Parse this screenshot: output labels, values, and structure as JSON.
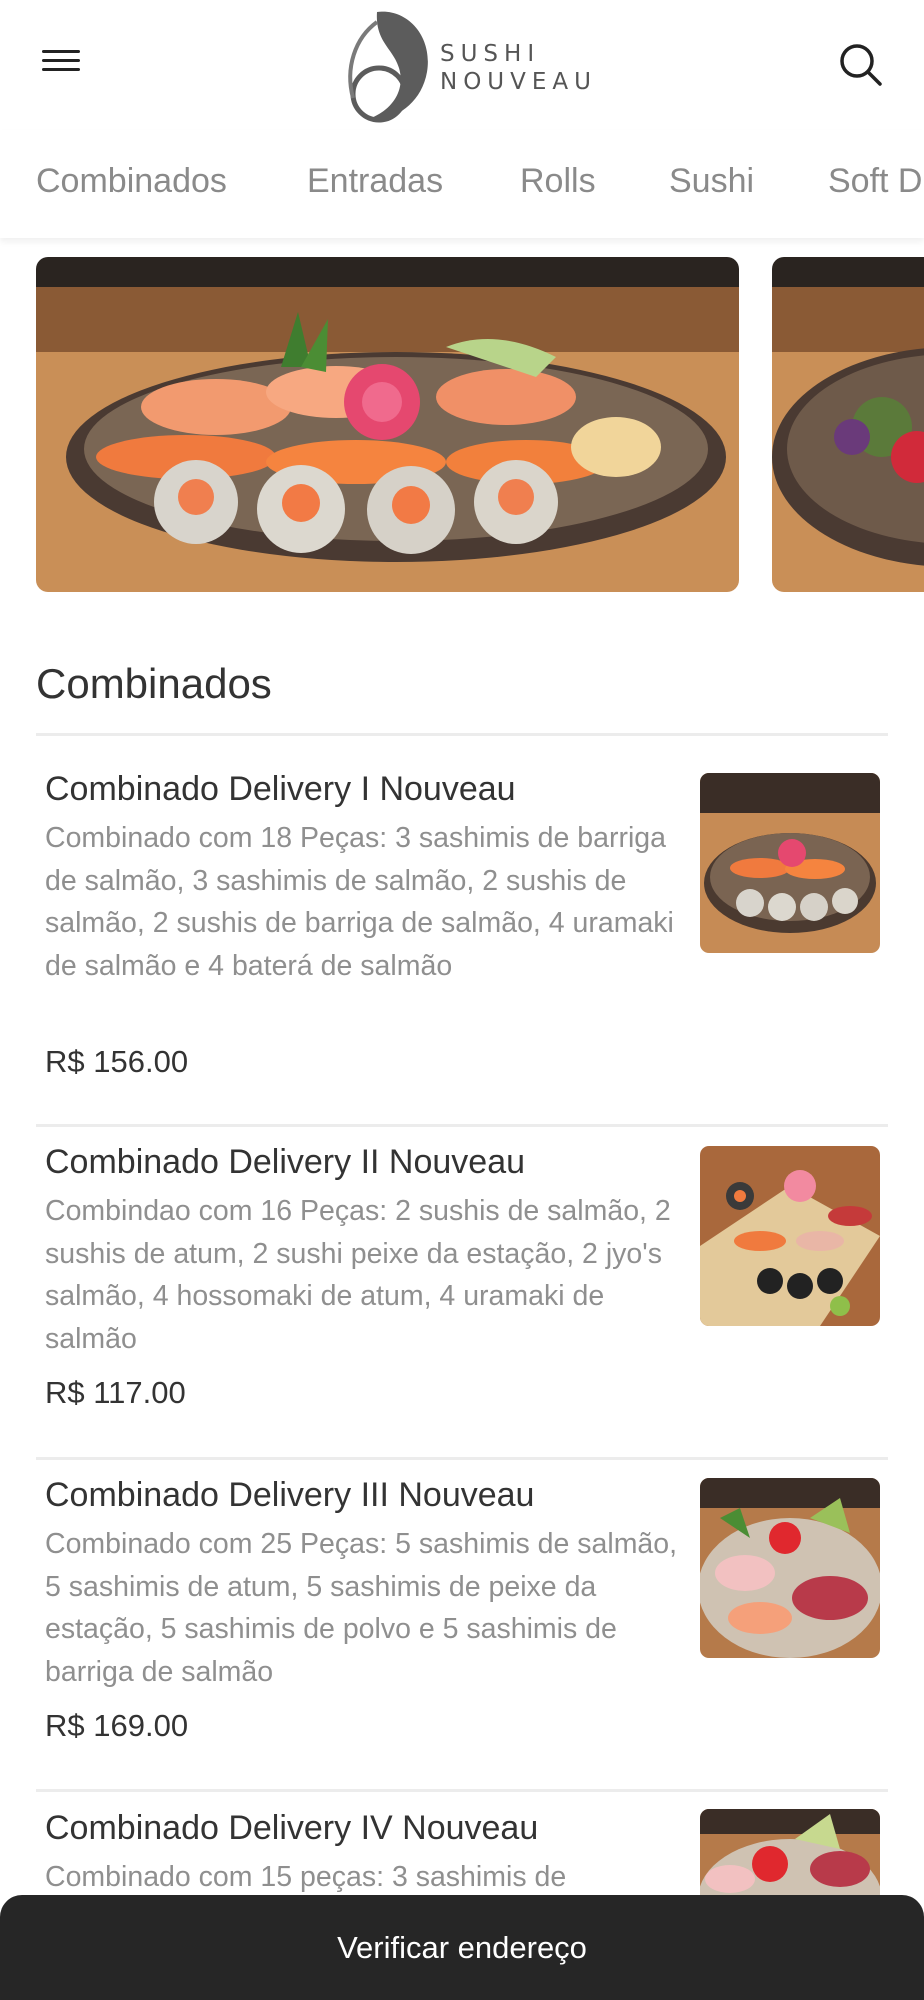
{
  "header": {
    "logo_line1": "SUSHI",
    "logo_line2": "NOUVEAU",
    "menu_icon": "hamburger-menu-icon",
    "search_icon": "search-icon"
  },
  "tabs": [
    {
      "label": "Combinados"
    },
    {
      "label": "Entradas"
    },
    {
      "label": "Rolls"
    },
    {
      "label": "Sushi"
    },
    {
      "label": "Soft Drinks"
    }
  ],
  "section": {
    "title": "Combinados"
  },
  "items": [
    {
      "name": "Combinado Delivery I Nouveau",
      "description": "Combinado com 18 Peças: 3 sashimis de barriga de salmão, 3 sashimis de salmão, 2 sushis de salmão, 2 sushis de barriga de salmão, 4 uramaki de salmão e 4 baterá de salmão",
      "price": "R$ 156.00"
    },
    {
      "name": "Combinado Delivery II Nouveau",
      "description": "Combindao com 16 Peças: 2 sushis de salmão, 2 sushis de atum, 2 sushi peixe da estação, 2 jyo's salmão, 4 hossomaki de atum, 4 uramaki de salmão",
      "price": "R$ 117.00"
    },
    {
      "name": "Combinado Delivery III Nouveau",
      "description": "Combinado com 25 Peças: 5 sashimis de salmão, 5 sashimis de atum, 5 sashimis de peixe da estação, 5 sashimis de polvo e 5 sashimis de barriga de salmão",
      "price": "R$ 169.00"
    },
    {
      "name": "Combinado Delivery IV Nouveau",
      "description": "Combinado com 15 peças: 3 sashimis de",
      "price": ""
    }
  ],
  "cta": {
    "label": "Verificar endereço"
  },
  "colors": {
    "cta_background": "#262626",
    "tab_text": "#8a8a8a",
    "description_text": "#8f8f8f"
  }
}
